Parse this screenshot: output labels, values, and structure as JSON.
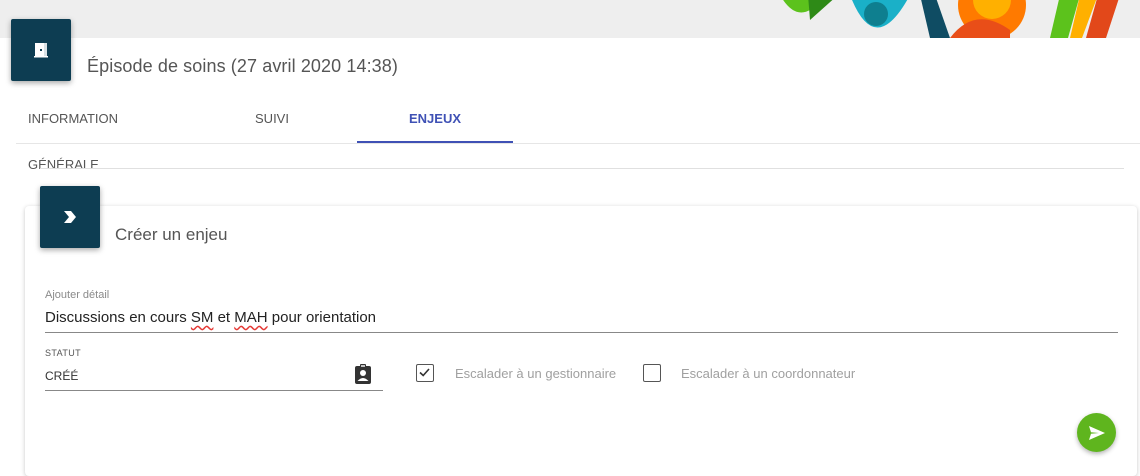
{
  "header": {
    "title": "Épisode de soins (27 avril 2020 14:38)",
    "icon": "door-exit-icon"
  },
  "tabs": [
    {
      "label": "INFORMATION GÉNÉRALE",
      "active": false
    },
    {
      "label": "SUIVI",
      "active": false
    },
    {
      "label": "ENJEUX",
      "active": true
    }
  ],
  "card": {
    "title": "Créer un enjeu",
    "icon": "chevron-right-icon",
    "detail": {
      "label": "Ajouter détail",
      "value_parts": [
        "Discussions en cours ",
        "SM",
        " et ",
        "MAH",
        " pour orientation"
      ]
    },
    "statut": {
      "label": "STATUT",
      "value": "CRÉÉ",
      "icon": "clipboard-account-icon"
    },
    "escalate_manager": {
      "label": "Escalader à un gestionnaire",
      "checked": true
    },
    "escalate_coordinator": {
      "label": "Escalader à un coordonnateur",
      "checked": false
    },
    "submit_icon": "send-icon"
  },
  "colors": {
    "tile": "#0d3d52",
    "accent": "#3f51b5",
    "submit": "#5fb51e"
  }
}
